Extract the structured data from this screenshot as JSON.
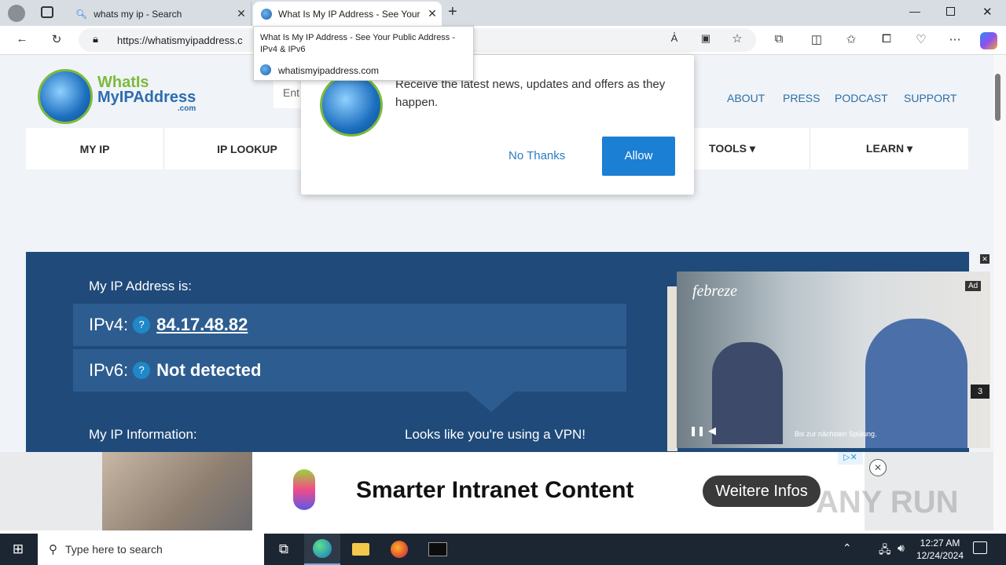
{
  "browser": {
    "tabs": [
      {
        "title": "whats my ip - Search",
        "icon": "search-icon"
      },
      {
        "title": "What Is My IP Address - See Your",
        "icon": "globe-icon"
      }
    ],
    "url": "https://whatismyipaddress.c",
    "tooltip": {
      "title": "What Is My IP Address - See Your Public Address - IPv4 & IPv6",
      "domain": "whatismyipaddress.com"
    }
  },
  "site": {
    "logo_line1": "WhatIs",
    "logo_line2": "MyIPAddress",
    "logo_line3": ".com",
    "search_placeholder": "Ent",
    "top_links": [
      "ABOUT",
      "PRESS",
      "PODCAST",
      "SUPPORT"
    ],
    "nav": [
      "MY IP",
      "IP LOOKUP",
      "TOOLS ▾",
      "LEARN ▾"
    ]
  },
  "popup": {
    "text": "Receive the latest news, updates and offers as they happen.",
    "no_thanks": "No Thanks",
    "allow": "Allow"
  },
  "ip": {
    "heading": "My IP Address is:",
    "ipv4_label": "IPv4:",
    "ipv4_value": "84.17.48.82",
    "ipv6_label": "IPv6:",
    "ipv6_value": "Not detected",
    "info_heading": "My IP Information:",
    "vpn_text": "Looks like you're using a VPN!",
    "help": "?"
  },
  "video_ad": {
    "brand": "febreze",
    "badge": "Ad",
    "counter": "3",
    "subtitle": "Bis zur nächsten Spülung."
  },
  "banner_ad": {
    "headline": "Smarter Intranet Content",
    "cta": "Weitere Infos",
    "watermark": "ANY RUN"
  },
  "taskbar": {
    "search_placeholder": "Type here to search",
    "time": "12:27 AM",
    "date": "12/24/2024"
  }
}
